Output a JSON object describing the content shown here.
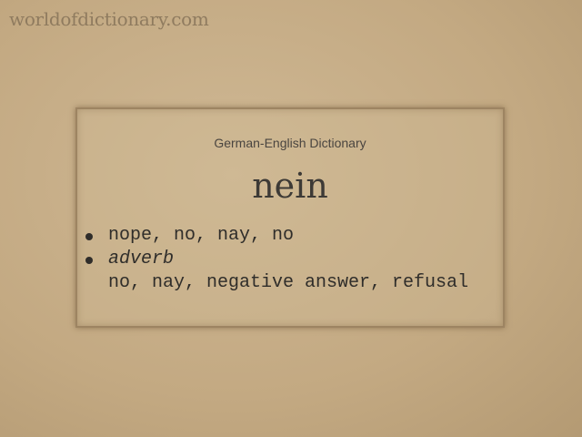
{
  "site": "worldofdictionary.com",
  "card": {
    "subtitle": "German-English Dictionary",
    "word": "nein",
    "definitions": [
      {
        "text": "nope, no, nay, no"
      },
      {
        "pos": "adverb",
        "text": "no, nay, negative answer, refusal"
      }
    ]
  }
}
